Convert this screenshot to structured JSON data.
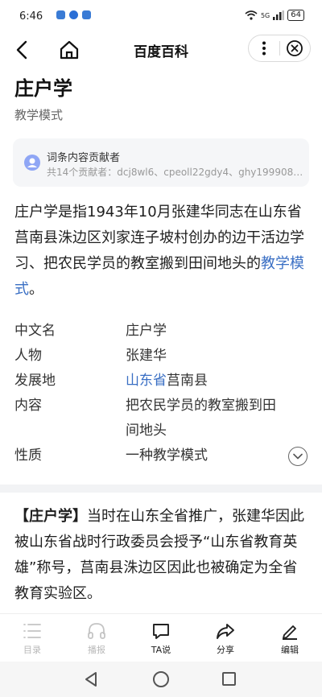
{
  "status_bar": {
    "time": "6:46",
    "network": "5G",
    "battery": "64"
  },
  "header": {
    "title": "百度百科"
  },
  "article": {
    "title": "庄户学",
    "subtitle": "教学模式",
    "contributors": {
      "label": "词条内容贡献者",
      "names": "共14个贡献者：dcj8wl6、cpeoll22gdy4、ghy199908…"
    },
    "summary_before": "庄户学是指1943年10月张建华同志在山东省莒南县洙边区刘家连子坡村创办的边干活边学习、把农民学员的教室搬到田间地头的",
    "summary_link": "教学模式",
    "summary_after": "。",
    "infobox": {
      "rows": [
        {
          "key": "中文名",
          "value": "庄户学"
        },
        {
          "key": "人物",
          "value": "张建华"
        },
        {
          "key": "发展地",
          "value_link": "山东省",
          "value_rest": "莒南县"
        },
        {
          "key": "内容",
          "value": "把农民学员的教室搬到田间地头"
        },
        {
          "key": "性质",
          "value": "一种教学模式"
        }
      ]
    },
    "paragraph_bold": "【庄户学】",
    "paragraph_text": "当时在山东全省推广，张建华因此被山东省战时行政委员会授予“山东省教育英雄”称号，莒南县洙边区因此也被确定为全省教育实验区。"
  },
  "toolbar": {
    "items": [
      {
        "label": "目录",
        "icon": "list-icon"
      },
      {
        "label": "播报",
        "icon": "headphones-icon"
      },
      {
        "label": "TA说",
        "icon": "chat-bubble-icon"
      },
      {
        "label": "分享",
        "icon": "share-icon"
      },
      {
        "label": "编辑",
        "icon": "pencil-icon"
      }
    ]
  },
  "colors": {
    "link": "#3a6fc4",
    "divider": "#f2f3f5",
    "contrib_bg": "#f5f6f8"
  }
}
